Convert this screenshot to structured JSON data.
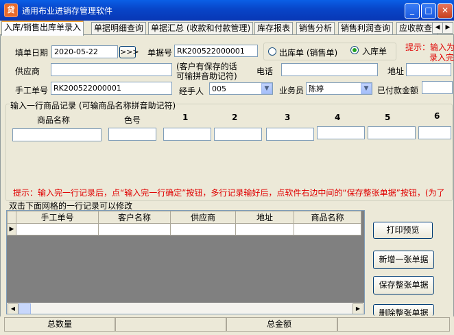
{
  "window": {
    "title": "通用布业进销存管理软件",
    "minimize": "_",
    "maximize": "□",
    "close": "✕"
  },
  "tabs": [
    "入库/销售出库单录入",
    "单据明细查询",
    "单据汇总 (收款和付款管理)",
    "库存报表",
    "销售分析",
    "销售利润查询",
    "应收款查"
  ],
  "form": {
    "date_label": "填单日期",
    "date_value": "2020-05-22",
    "date_btn": ">>>",
    "docno_label": "单据号",
    "docno_value": "RK200522000001",
    "radio_out": "出库单 (销售单)",
    "radio_in": "入库单",
    "hint_top": "提示：输入为",
    "hint_top2": "录入完",
    "supplier_label": "供应商",
    "customer_hint1": "(客户有保存的话",
    "customer_hint2": "可输拼音助记符)",
    "phone_label": "电话",
    "address_label": "地址",
    "manual_no_label": "手工单号",
    "manual_no_value": "RK200522000001",
    "handler_label": "经手人",
    "handler_value": "005",
    "salesman_label": "业务员",
    "salesman_value": "陈婷",
    "paid_label": "已付款金额"
  },
  "entry": {
    "group_label": "输入一行商品记录 (可输商品名称拼音助记符)",
    "columns": [
      "商品名称",
      "色号",
      "1",
      "2",
      "3",
      "4",
      "5",
      "6"
    ],
    "hint": "提示：输入完一行记录后，点“输入完一行确定”按钮，多行记录输好后，点软件右边中间的“保存整张单据”按钮，(为了"
  },
  "grid": {
    "group_label": "双击下面网格的一行记录可以修改",
    "columns": [
      "",
      "手工单号",
      "客户名称",
      "供应商",
      "地址",
      "商品名称"
    ]
  },
  "buttons": {
    "print": "打印预览",
    "new_doc": "新增一张单据",
    "save_doc": "保存整张单据",
    "delete_doc": "删除整张单据"
  },
  "status": {
    "total_qty": "总数量",
    "total_amount": "总金额"
  }
}
